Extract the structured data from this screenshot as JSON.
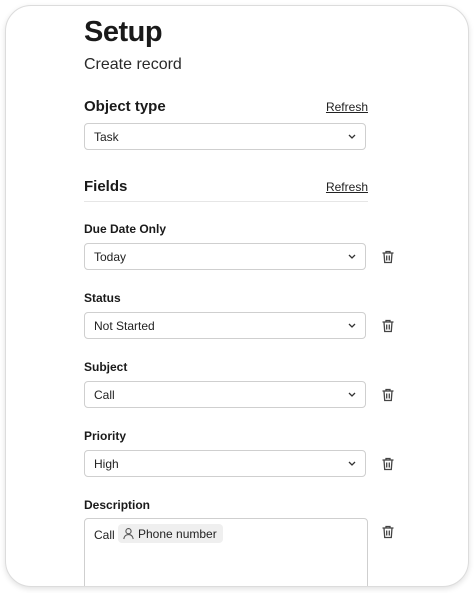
{
  "header": {
    "title": "Setup",
    "subtitle": "Create record"
  },
  "object_type": {
    "title": "Object type",
    "refresh_label": "Refresh",
    "selected": "Task"
  },
  "fields": {
    "title": "Fields",
    "refresh_label": "Refresh",
    "items": [
      {
        "label": "Due Date Only",
        "value": "Today"
      },
      {
        "label": "Status",
        "value": "Not Started"
      },
      {
        "label": "Subject",
        "value": "Call"
      },
      {
        "label": "Priority",
        "value": "High"
      }
    ],
    "description": {
      "label": "Description",
      "text": "Call",
      "token_label": "Phone number",
      "token_icon": "person-icon"
    }
  },
  "icons": {
    "dropdown": "chevron-down-icon",
    "delete": "trash-icon"
  }
}
